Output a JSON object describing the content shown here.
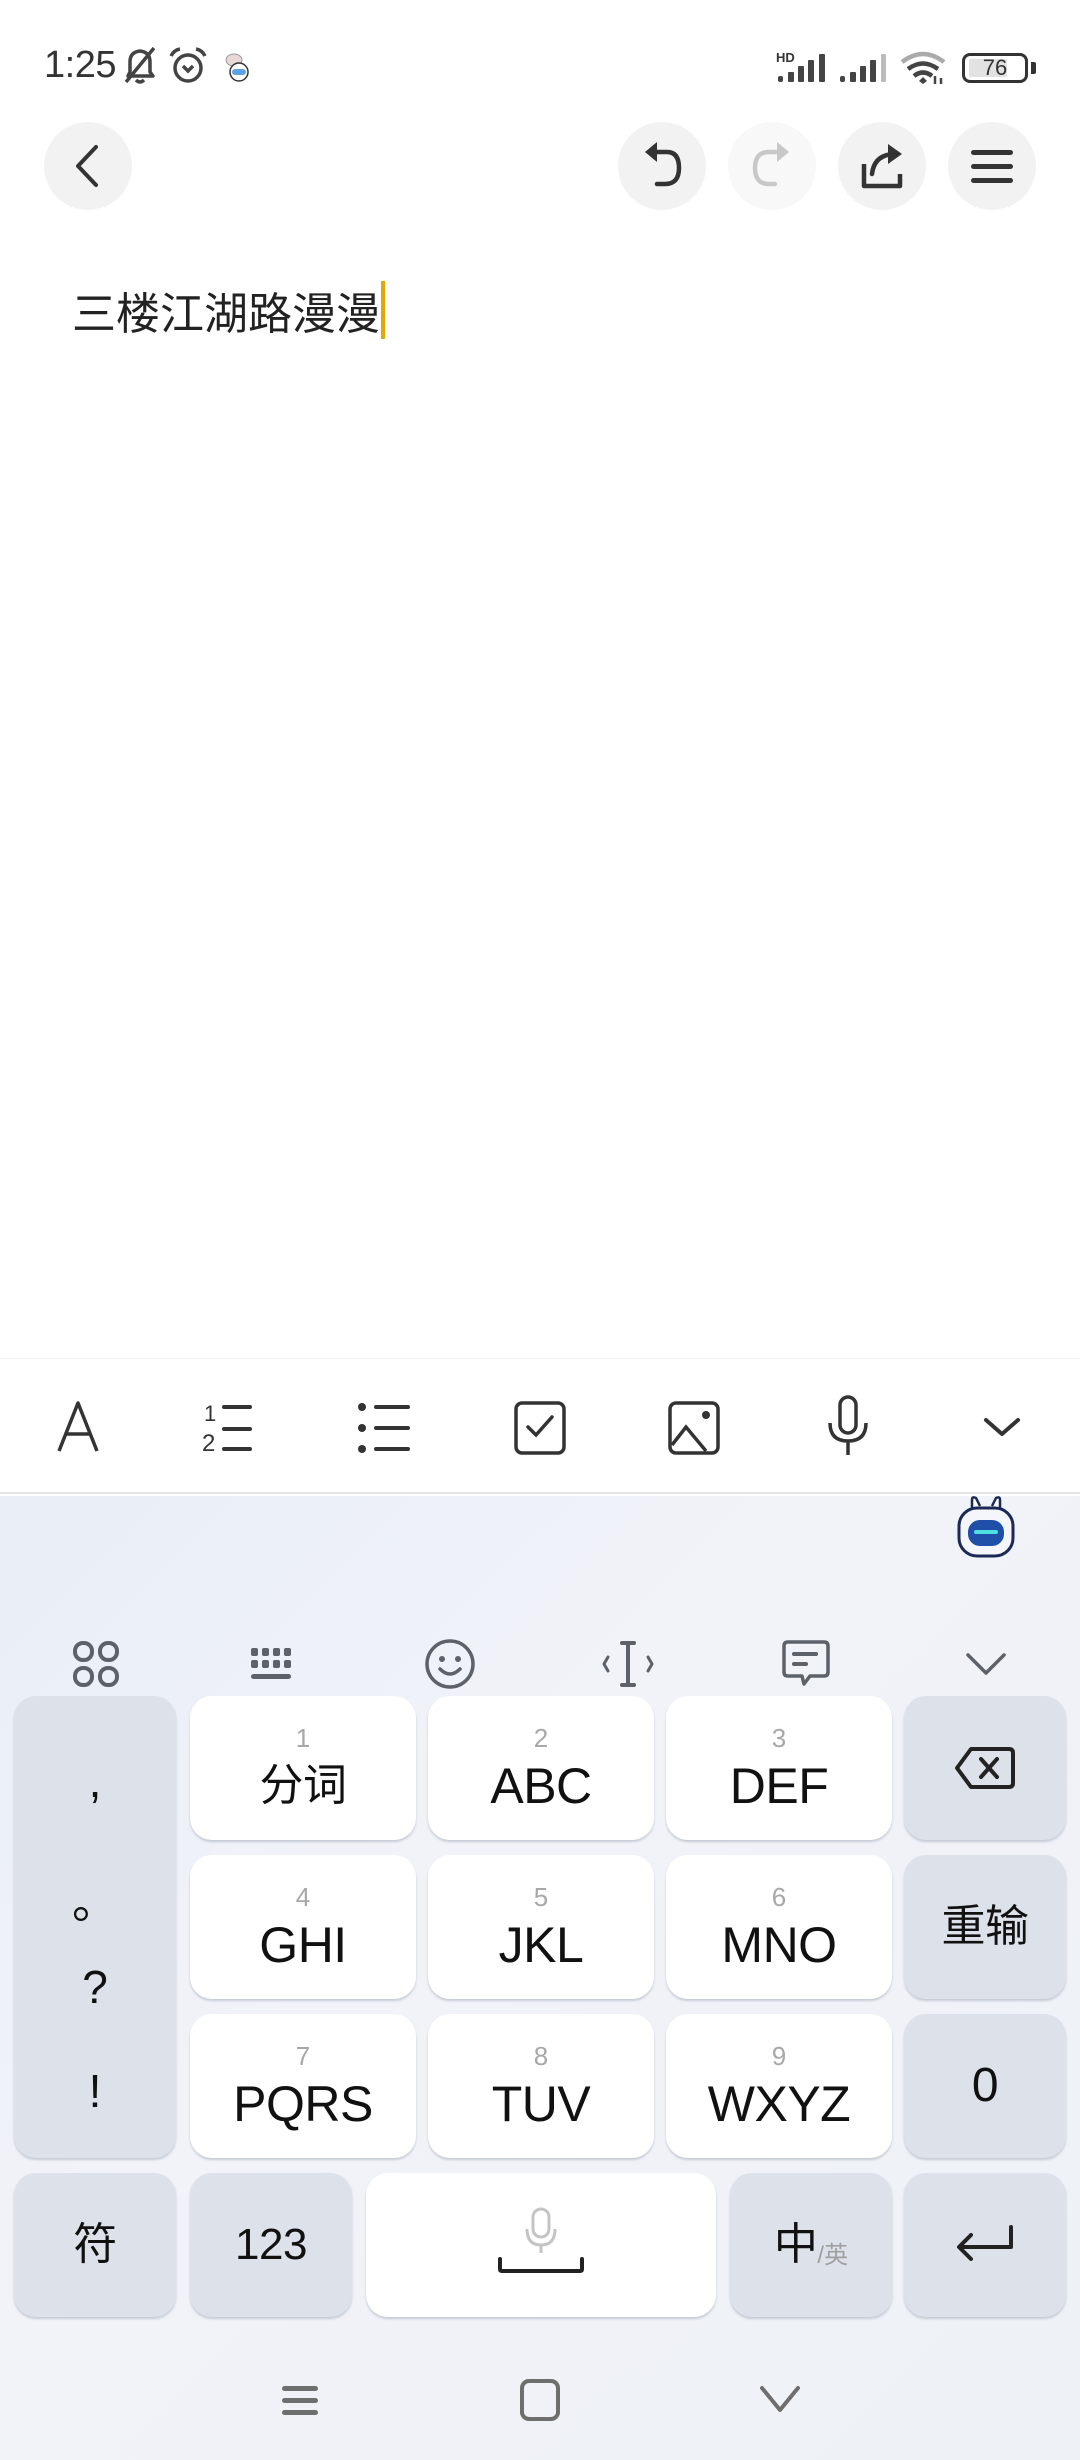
{
  "status_bar": {
    "time": "1:25",
    "icons": [
      "bell-off-icon",
      "alarm-icon",
      "app-notification-icon",
      "hd-signal-icon",
      "signal-icon",
      "wifi-icon"
    ],
    "battery": {
      "level_percent": 76,
      "text": "76"
    }
  },
  "top_toolbar": {
    "back": "back-icon",
    "undo": "undo-icon",
    "redo": {
      "icon": "redo-icon",
      "enabled": false
    },
    "share": "share-icon",
    "menu": "menu-icon"
  },
  "editor": {
    "content": "三楼江湖路漫漫"
  },
  "format_bar": {
    "items": [
      "text-style-icon",
      "numbered-list-icon",
      "bullet-list-icon",
      "checkbox-icon",
      "image-icon",
      "microphone-icon",
      "collapse-icon"
    ]
  },
  "keyboard": {
    "colors": {
      "light_key": "#ffffff",
      "dark_key": "#dde2ea",
      "caret": "#e6a800"
    },
    "toolbar": [
      "apps-grid-icon",
      "keyboard-layout-icon",
      "emoji-icon",
      "cursor-move-icon",
      "clipboard-phrase-icon",
      "hide-keyboard-icon"
    ],
    "punctuation": [
      ",",
      "。",
      "?",
      "!"
    ],
    "keys": [
      {
        "num": "1",
        "label": "分词"
      },
      {
        "num": "2",
        "label": "ABC"
      },
      {
        "num": "3",
        "label": "DEF"
      },
      {
        "num": "4",
        "label": "GHI"
      },
      {
        "num": "5",
        "label": "JKL"
      },
      {
        "num": "6",
        "label": "MNO"
      },
      {
        "num": "7",
        "label": "PQRS"
      },
      {
        "num": "8",
        "label": "TUV"
      },
      {
        "num": "9",
        "label": "WXYZ"
      }
    ],
    "right_column": {
      "backspace": "backspace-icon",
      "retype": "重输",
      "zero": "0"
    },
    "bottom_row": {
      "symbols": "符",
      "numbers": "123",
      "space": "space-icon",
      "lang_primary": "中",
      "lang_secondary": "/英",
      "enter": "enter-icon"
    }
  },
  "nav_bar": [
    "recents-icon",
    "home-icon",
    "back-nav-icon"
  ]
}
